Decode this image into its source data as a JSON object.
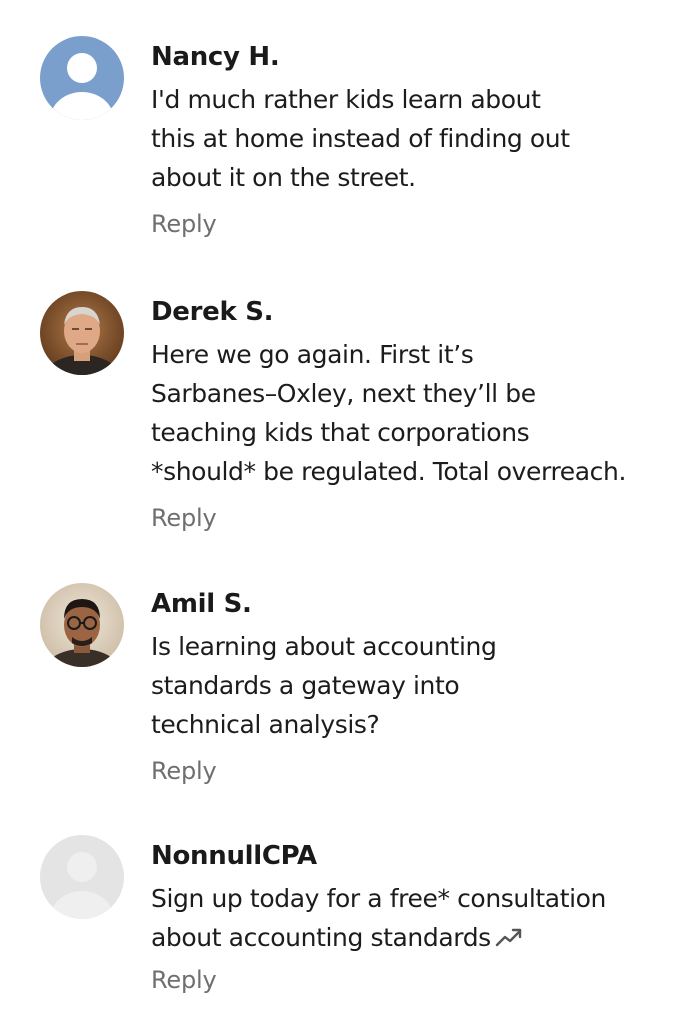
{
  "comments": [
    {
      "author": "Nancy H.",
      "lines": [
        "I'd much rather kids learn about",
        "this at home instead of finding out",
        "about it on the street."
      ],
      "reply_label": "Reply",
      "avatar": "default-avatar-blue"
    },
    {
      "author": "Derek S.",
      "lines": [
        "Here we go again. First it’s",
        "Sarbanes–Oxley, next they’ll be",
        "teaching kids that corporations",
        "*should* be regulated. Total overreach."
      ],
      "reply_label": "Reply",
      "avatar": "photo-avatar-older-man"
    },
    {
      "author": "Amil S.",
      "lines": [
        "Is learning about accounting",
        "standards a gateway into",
        "technical analysis?"
      ],
      "reply_label": "Reply",
      "avatar": "photo-avatar-man-glasses"
    },
    {
      "author": "NonnullCPA",
      "lines": [
        "Sign up today for a free* consultation",
        "about accounting standards"
      ],
      "reply_label": "Reply",
      "avatar": "default-avatar-gray",
      "trailing_icon": "trending-up-icon"
    }
  ],
  "colors": {
    "author": "#1a1a1a",
    "text": "#1c1c1c",
    "reply": "#6f6f6f",
    "avatar_blue_bg": "#7b9fcd",
    "avatar_gray_bg": "#e4e4e4"
  }
}
